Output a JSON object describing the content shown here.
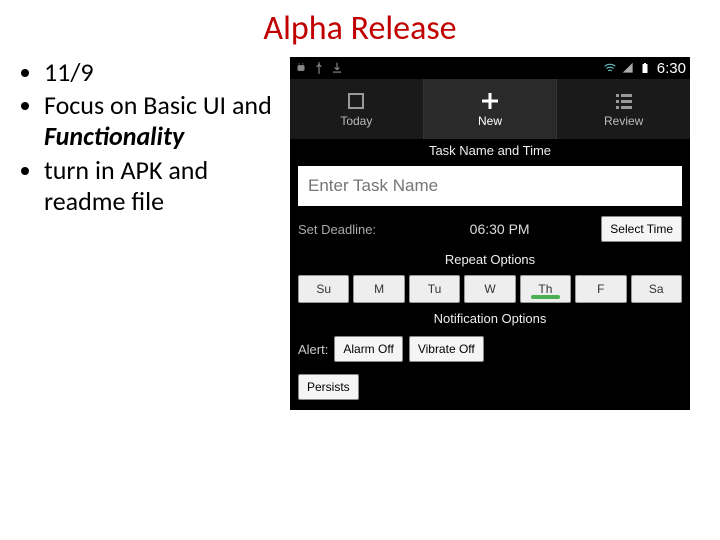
{
  "title": "Alpha Release",
  "bullets": {
    "b1": "11/9",
    "b2a": "Focus on Basic UI and ",
    "b2b": "Functionality",
    "b3": "turn in APK and readme file"
  },
  "statusbar": {
    "time": "6:30"
  },
  "tabs": {
    "today": "Today",
    "new": "New",
    "review": "Review"
  },
  "sections": {
    "task_name_time": "Task Name and Time",
    "repeat": "Repeat Options",
    "notification": "Notification Options"
  },
  "task_input": {
    "placeholder": "Enter Task Name"
  },
  "deadline": {
    "label": "Set Deadline:",
    "time": "06:30 PM",
    "select_time": "Select Time"
  },
  "days": {
    "su": "Su",
    "m": "M",
    "tu": "Tu",
    "w": "W",
    "th": "Th",
    "f": "F",
    "sa": "Sa"
  },
  "alert": {
    "label": "Alert:",
    "alarm_off": "Alarm Off",
    "vibrate_off": "Vibrate Off"
  },
  "persists": {
    "label": "Persists"
  }
}
